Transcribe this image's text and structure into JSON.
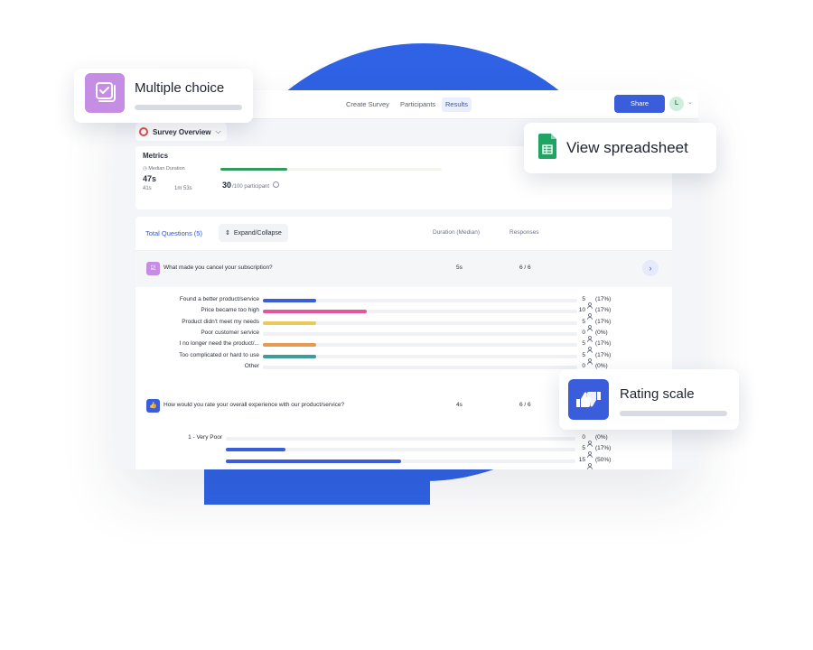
{
  "nav": {
    "tabs": [
      {
        "label": "Create Survey"
      },
      {
        "label": "Participants"
      },
      {
        "label": "Results",
        "active": true
      }
    ],
    "share_label": "Share",
    "avatar_initial": "L"
  },
  "overview": {
    "label": "Survey Overview",
    "icon": "target-icon"
  },
  "metrics": {
    "title": "Metrics",
    "median_label": "Median Duration",
    "median_value": "47s",
    "range_min": "41s",
    "range_max": "1m 53s",
    "participants_count": "30",
    "participants_suffix": "/100 participant",
    "participants_progress": 0.3
  },
  "questions": {
    "total_label": "Total Questions (5)",
    "expand_label": "Expand/Collapse",
    "col_duration": "Duration (Median)",
    "col_responses": "Responses",
    "q1": {
      "text": "What made you cancel your subscription?",
      "duration": "5s",
      "responses": "6 / 6",
      "icon": "multiple-choice-icon",
      "answers": [
        {
          "label": "Found a better product/service",
          "count": "5",
          "pct": "(17%)",
          "value": 0.17,
          "color": "#3a5ddb"
        },
        {
          "label": "Price became too high",
          "count": "10",
          "pct": "(17%)",
          "value": 0.33,
          "color": "#e5559b"
        },
        {
          "label": "Product didn't meet my needs",
          "count": "5",
          "pct": "(17%)",
          "value": 0.17,
          "color": "#e8cb5a"
        },
        {
          "label": "Poor customer service",
          "count": "0",
          "pct": "(0%)",
          "value": 0,
          "color": "#8e97a8"
        },
        {
          "label": "I no longer need the product/...",
          "count": "5",
          "pct": "(17%)",
          "value": 0.17,
          "color": "#e89a52"
        },
        {
          "label": "Too complicated or hard to use",
          "count": "5",
          "pct": "(17%)",
          "value": 0.17,
          "color": "#3e9c9c"
        },
        {
          "label": "Other",
          "count": "0",
          "pct": "(0%)",
          "value": 0,
          "color": "#8e97a8"
        }
      ]
    },
    "q2": {
      "text": "How would you rate your overall experience with our product/service?",
      "duration": "4s",
      "responses": "6 / 6",
      "icon": "rating-icon",
      "answers": [
        {
          "label": "1 - Very Poor",
          "count": "0",
          "pct": "(0%)",
          "value": 0,
          "color": "#3a5ddb"
        },
        {
          "label": "",
          "count": "5",
          "pct": "(17%)",
          "value": 0.17,
          "color": "#3a5ddb"
        },
        {
          "label": "",
          "count": "15",
          "pct": "(50%)",
          "value": 0.5,
          "color": "#3a5ddb"
        }
      ]
    }
  },
  "cards": {
    "multiple_choice": "Multiple choice",
    "view_spreadsheet": "View spreadsheet",
    "rating_scale": "Rating scale"
  },
  "colors": {
    "brand_blue": "#2f62e4",
    "accent_green": "#2f9c5d",
    "multiple_choice_purple": "#c58de3"
  }
}
